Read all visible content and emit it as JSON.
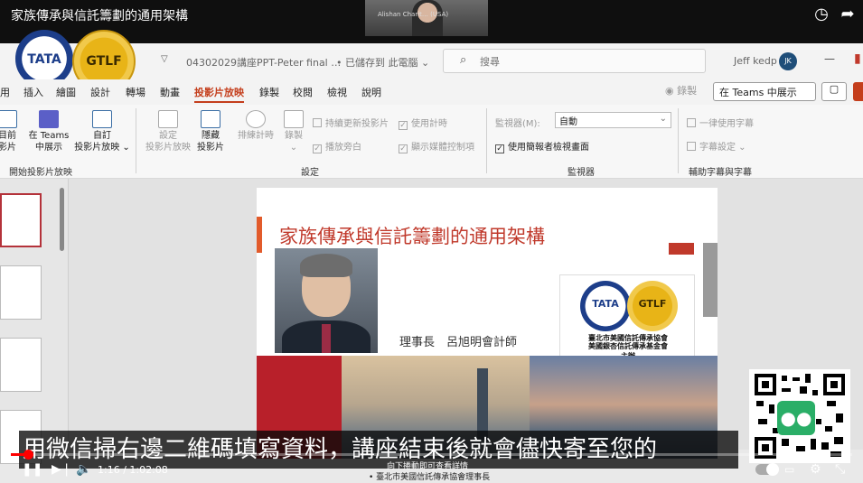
{
  "video": {
    "title": "家族傳承與信託籌劃的通用架構",
    "webcam_text": "Alishan Charit… (USA)",
    "clock_icon": "clock-icon",
    "share_icon": "share-arrow-icon"
  },
  "logos": {
    "tata": "TATA",
    "gtlf": "GTLF"
  },
  "office": {
    "doc_name": "04302029講座PPT-Peter final …",
    "saved_status": "• 已儲存到 此電腦 ⌄",
    "search_placeholder": "搜尋",
    "user_name": "Jeff kedp",
    "avatar": "JK"
  },
  "ribbon": {
    "tabs": [
      "用",
      "插入",
      "繪圖",
      "設計",
      "轉場",
      "動畫",
      "投影片放映",
      "錄製",
      "校閱",
      "檢視",
      "說明"
    ],
    "active_tab": "投影片放映",
    "record_label": "◉ 錄製",
    "teams_label": "在 Teams 中展示",
    "comment_label": "▢",
    "buttons": {
      "from_current": "目前\n影片",
      "present_teams": "在 Teams\n中展示",
      "custom_show": "自訂\n投影片放映 ⌄",
      "setup_show": "設定\n投影片放映",
      "hide_slide": "隱藏\n投影片",
      "rehearse": "排練計時",
      "record": "錄製\n⌄"
    },
    "checkboxes": {
      "keep_updated": "持續更新投影片",
      "use_timings": "使用計時",
      "play_narrations": "播放旁白",
      "show_media_controls": "顯示媒體控制項",
      "always_subtitles": "一律使用字幕",
      "subtitle_settings": "字幕設定 ⌄",
      "use_presenter_view": "使用簡報者檢視畫面"
    },
    "monitor_label": "監視器(M):",
    "monitor_value": "自動",
    "groups": {
      "start": "開始投影片放映",
      "setup": "設定",
      "monitors": "監視器",
      "captions": "輔助字幕與字幕"
    }
  },
  "slide": {
    "title": "家族傳承與信託籌劃的通用架構",
    "chairman": "理事長　呂旭明會計師",
    "org1": "臺北市美國信託傳承協會",
    "org2": "美國銀杏信託傳承基金會",
    "host": "主辦",
    "mini_tata": "TATA",
    "mini_gtlf": "GTLF"
  },
  "caption": {
    "text": "用微信掃右邊二維碼填寫資料，講座結束後就會儘快寄至您的",
    "hint": "向下捲動即可查看詳情",
    "footer": "• 臺北市美國信託傳承協會理事長"
  },
  "player": {
    "current_time": "1:16",
    "duration": "1:02:08",
    "time_text": "1:16 / 1:02:08",
    "progress_fraction": 0.0204,
    "play_icon": "pause-icon",
    "next_icon": "next-icon",
    "volume_icon": "volume-icon",
    "autoplay_icon": "autoplay-toggle",
    "subtitles_icon": "subtitles-icon",
    "settings_icon": "gear-icon",
    "exit_fullscreen_icon": "exit-fullscreen-icon"
  },
  "colors": {
    "accent": "#c43e1c",
    "progress": "#ff0000",
    "slide_title": "#c0392b"
  }
}
